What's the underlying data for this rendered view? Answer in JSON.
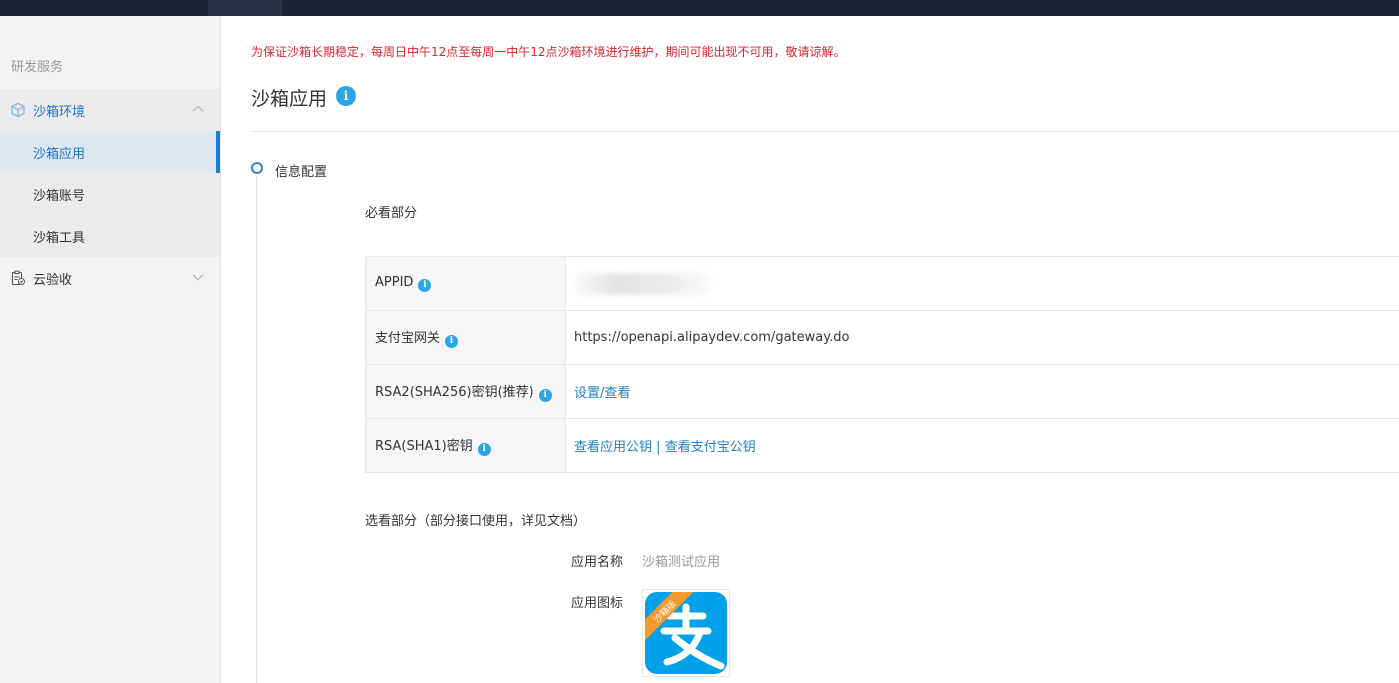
{
  "sidebar": {
    "section_title": "研发服务",
    "groups": [
      {
        "label": "沙箱环境",
        "icon": "cube-icon",
        "expanded": true,
        "items": [
          {
            "label": "沙箱应用",
            "active": true
          },
          {
            "label": "沙箱账号",
            "active": false
          },
          {
            "label": "沙箱工具",
            "active": false
          }
        ]
      },
      {
        "label": "云验收",
        "icon": "clipboard-check-icon",
        "expanded": false
      }
    ]
  },
  "main": {
    "notice": "为保证沙箱长期稳定，每周日中午12点至每周一中午12点沙箱环境进行维护，期间可能出现不可用，敬请谅解。",
    "title": "沙箱应用",
    "step": {
      "title": "信息配置",
      "required_label": "必看部分",
      "table": [
        {
          "label": "APPID",
          "value": "",
          "blurred": true
        },
        {
          "label": "支付宝网关",
          "value": "https://openapi.alipaydev.com/gateway.do"
        },
        {
          "label": "RSA2(SHA256)密钥(推荐)",
          "link": "设置/查看"
        },
        {
          "label": "RSA(SHA1)密钥",
          "link1": "查看应用公钥",
          "separator": "|",
          "link2": "查看支付宝公钥"
        }
      ],
      "optional_label": "选看部分（部分接口使用，详见文档）",
      "app_name_label": "应用名称",
      "app_name_value": "沙箱测试应用",
      "app_icon_label": "应用图标",
      "app_icon_badge": "沙箱版"
    }
  },
  "colors": {
    "topbar": "#1f2337",
    "accent": "#1e7ad7",
    "notice": "#d9262c",
    "link": "#1b7fc4",
    "alipay_blue": "#00a1e9",
    "badge_orange": "#f39a2e"
  }
}
